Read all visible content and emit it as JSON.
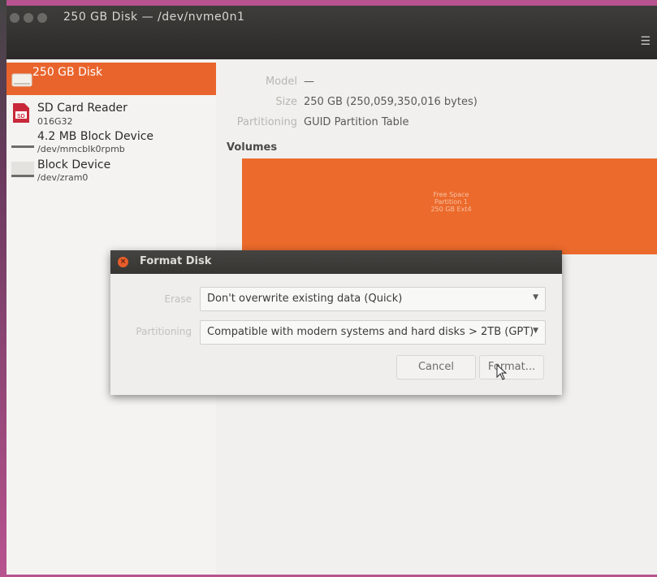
{
  "window": {
    "title": "250 GB Disk — /dev/nvme0n1"
  },
  "sidebar": {
    "items": [
      {
        "name": "250 GB Disk",
        "sub": "",
        "icon": "hdd-icon",
        "active": true
      },
      {
        "name": "SD Card Reader",
        "sub": "016G32",
        "icon": "sd-card-icon",
        "active": false
      },
      {
        "name": "4.2 MB Block Device",
        "sub": "/dev/mmcblk0rpmb",
        "icon": "block-device-icon",
        "active": false
      },
      {
        "name": "Block Device",
        "sub": "/dev/zram0",
        "icon": "block-device-icon",
        "active": false
      }
    ]
  },
  "disk": {
    "model_label": "Model",
    "model_value": "—",
    "size_label": "Size",
    "size_value": "250 GB (250,059,350,016 bytes)",
    "partitioning_label": "Partitioning",
    "partitioning_value": "GUID Partition Table",
    "volumes_title": "Volumes",
    "volume": {
      "line1": "Free Space",
      "line2": "Partition 1",
      "line3": "250 GB Ext4"
    }
  },
  "dialog": {
    "title": "Format Disk",
    "erase_label": "Erase",
    "erase_value": "Don't overwrite existing data (Quick)",
    "partitioning_label": "Partitioning",
    "partitioning_value": "Compatible with modern systems and hard disks > 2TB (GPT)",
    "cancel_label": "Cancel",
    "format_label": "Format..."
  },
  "colors": {
    "accent": "#e9642c",
    "titlebar": "#2f2e2b",
    "desktop": "#b8538f"
  }
}
